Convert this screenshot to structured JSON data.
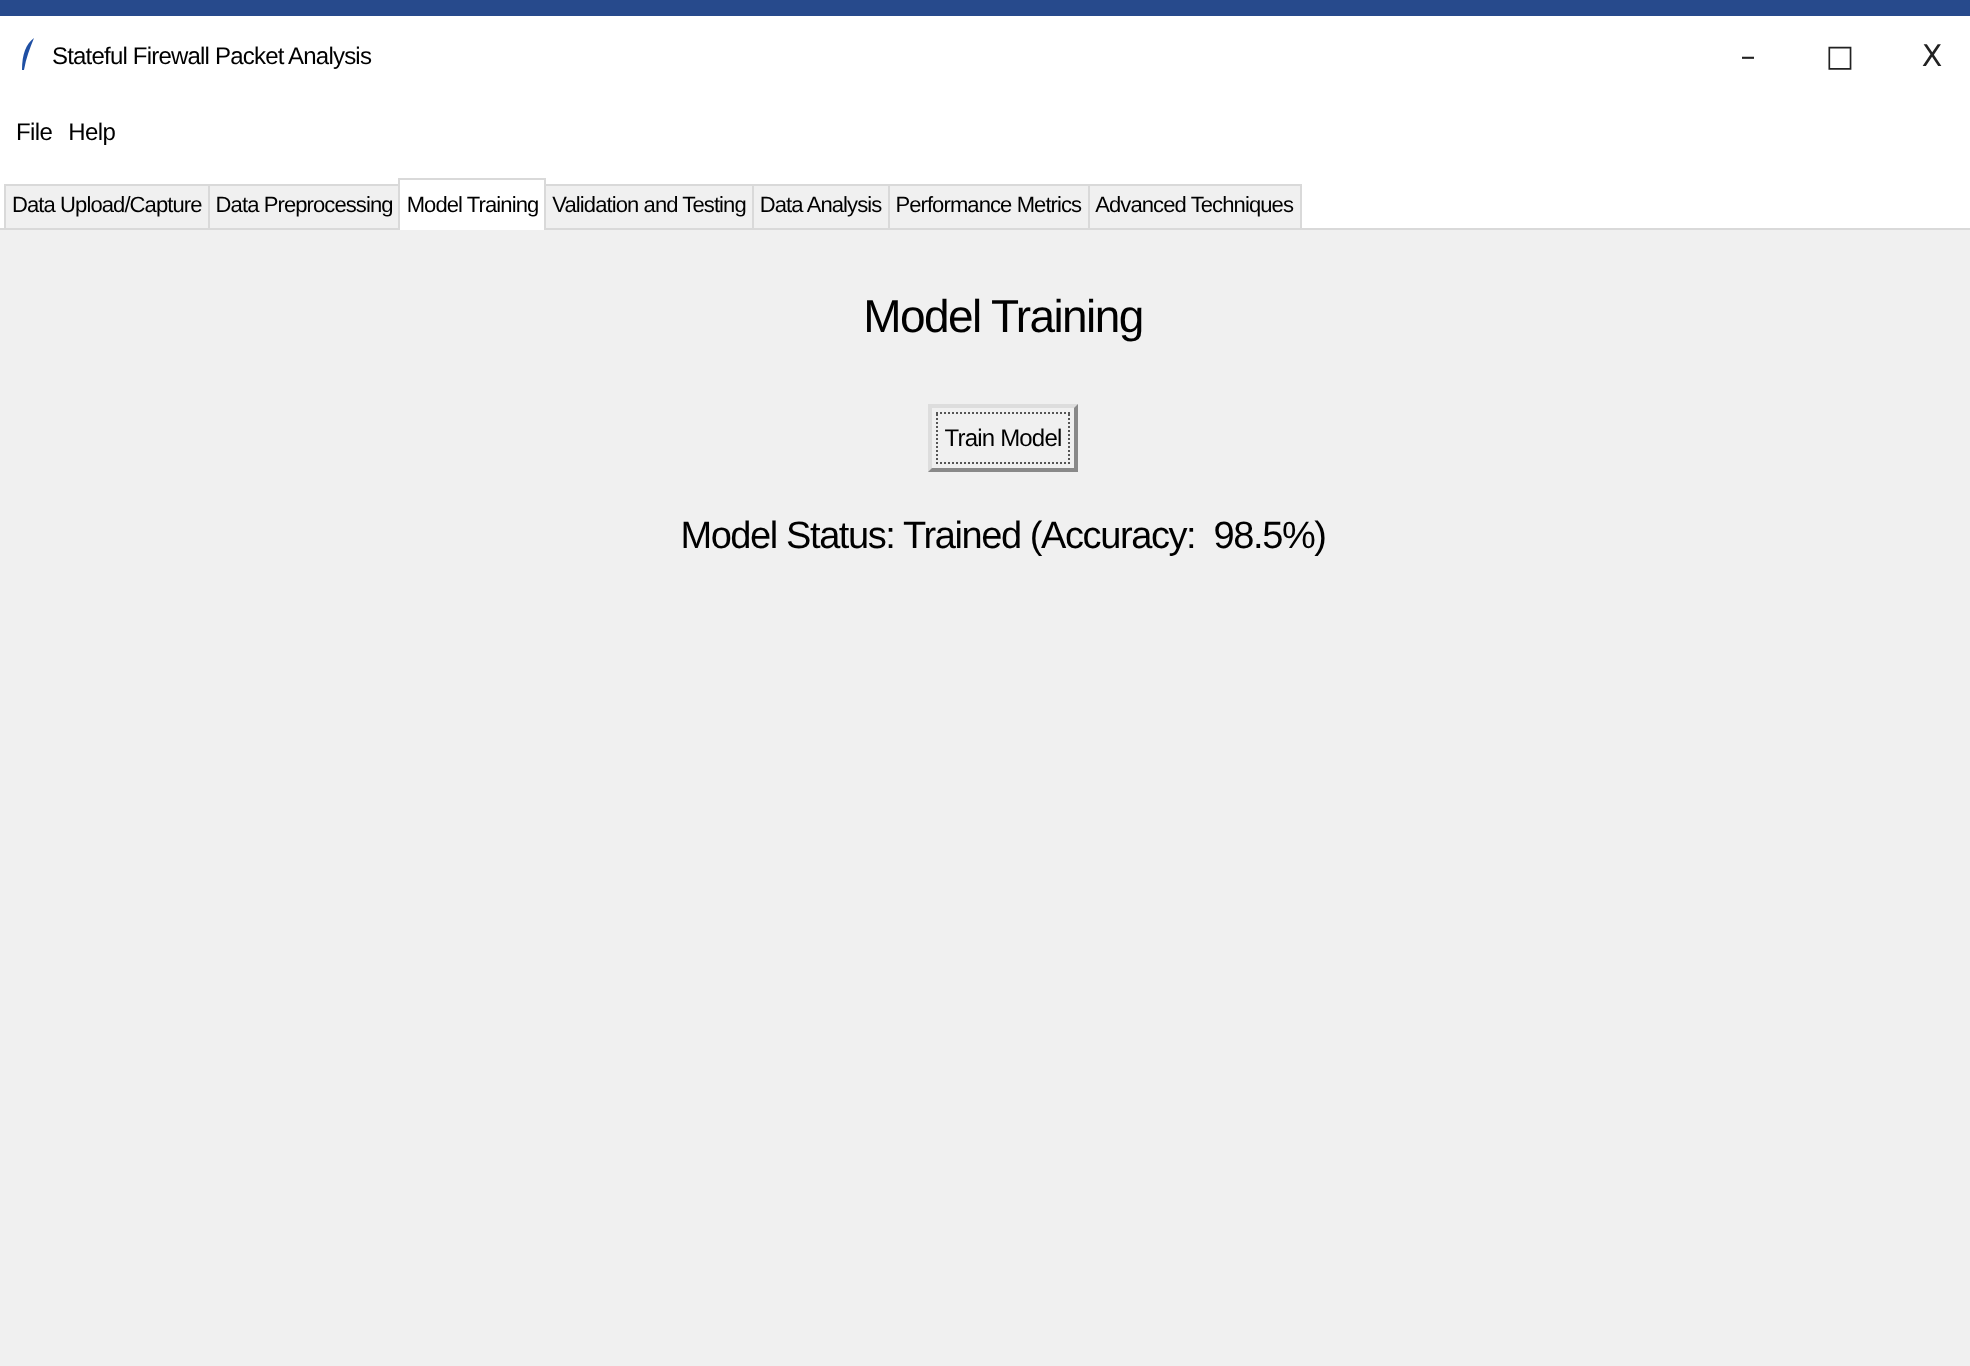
{
  "window": {
    "title": "Stateful Firewall Packet Analysis",
    "controls": [
      "–",
      "□",
      "X"
    ]
  },
  "menu": [
    "File",
    "Help"
  ],
  "tabs": [
    {
      "label": "Data Upload/Capture",
      "selected": false
    },
    {
      "label": "Data Preprocessing",
      "selected": false
    },
    {
      "label": "Model Training",
      "selected": true
    },
    {
      "label": "Validation and Testing",
      "selected": false
    },
    {
      "label": "Data Analysis",
      "selected": false
    },
    {
      "label": "Performance Metrics",
      "selected": false
    },
    {
      "label": "Advanced Techniques",
      "selected": false
    }
  ],
  "panel": {
    "heading": "Model Training",
    "button": "Train Model",
    "status": "Model Status: Trained (Accuracy:  98.5%)"
  }
}
